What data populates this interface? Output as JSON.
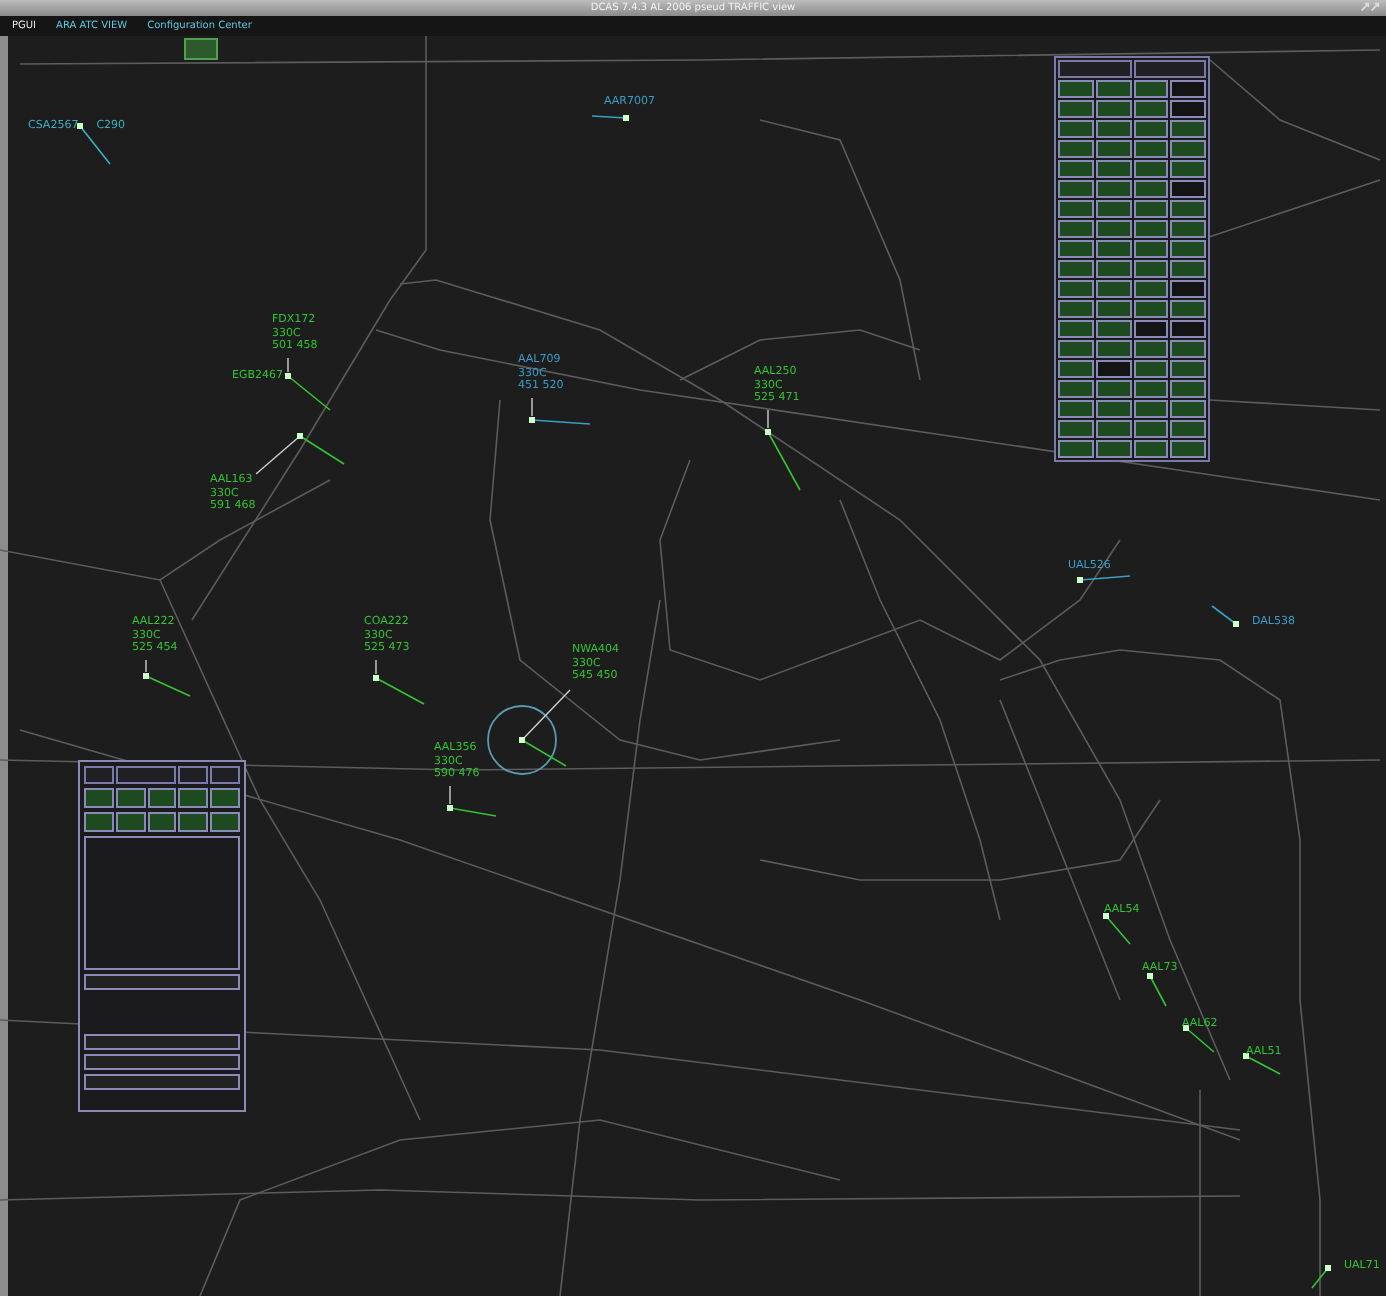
{
  "window": {
    "title": "DCAS 7.4.3 AL 2006 pseud TRAFFIC view"
  },
  "menu": [
    {
      "label": "PGUI"
    },
    {
      "label": "ARA ATC VIEW"
    },
    {
      "label": "Configuration Center"
    }
  ],
  "aircraft": [
    {
      "kind": "inline",
      "lines": [
        "CSA2567",
        "C290"
      ],
      "color": "#3ab0c0"
    },
    {
      "kind": "inline",
      "lines": [
        "AAR7007"
      ],
      "color": "#3a9ec8"
    },
    {
      "kind": "stacked",
      "lines": [
        "FDX172",
        "330C",
        "501 458"
      ],
      "color": "#33c433"
    },
    {
      "kind": "inline",
      "lines": [
        "EGB2467"
      ],
      "color": "#33c433"
    },
    {
      "kind": "stacked",
      "lines": [
        "AAL163",
        "330C",
        "591 468"
      ],
      "color": "#33c433"
    },
    {
      "kind": "stacked",
      "lines": [
        "AAL709",
        "330C",
        "451 520"
      ],
      "color": "#3a9ec8"
    },
    {
      "kind": "stacked",
      "lines": [
        "AAL250",
        "330C",
        "525 471"
      ],
      "color": "#33c433"
    },
    {
      "kind": "stacked",
      "lines": [
        "AAL222",
        "330C",
        "525 454"
      ],
      "color": "#33c433"
    },
    {
      "kind": "stacked",
      "lines": [
        "COA222",
        "330C",
        "525 473"
      ],
      "color": "#33c433"
    },
    {
      "kind": "stacked",
      "lines": [
        "NWA404",
        "330C",
        "545 450"
      ],
      "color": "#33c433"
    },
    {
      "kind": "stacked",
      "lines": [
        "AAL356",
        "330C",
        "590 476"
      ],
      "color": "#33c433"
    },
    {
      "kind": "inline",
      "lines": [
        "UAL526"
      ],
      "color": "#3a9ec8"
    },
    {
      "kind": "inline",
      "lines": [
        "DAL538"
      ],
      "color": "#3a9ec8"
    },
    {
      "kind": "inline",
      "lines": [
        "AAL54"
      ],
      "color": "#33c433"
    },
    {
      "kind": "inline",
      "lines": [
        "AAL73"
      ],
      "color": "#33c433"
    },
    {
      "kind": "inline",
      "lines": [
        "AAL62"
      ],
      "color": "#33c433"
    },
    {
      "kind": "inline",
      "lines": [
        "AAL51"
      ],
      "color": "#33c433"
    },
    {
      "kind": "inline",
      "lines": [
        "UAL71"
      ],
      "color": "#33c433"
    }
  ],
  "right_panel": {
    "rows": [
      [
        {
          "kind": "button"
        },
        {
          "kind": "button"
        },
        {
          "kind": "button"
        },
        {
          "kind": "empty"
        }
      ],
      [
        {
          "kind": "button"
        },
        {
          "kind": "button"
        },
        {
          "kind": "button"
        },
        {
          "kind": "empty"
        }
      ],
      [
        {
          "kind": "button"
        },
        {
          "kind": "button"
        },
        {
          "kind": "button"
        },
        {
          "kind": "button"
        }
      ],
      [
        {
          "kind": "button"
        },
        {
          "kind": "button"
        },
        {
          "kind": "button"
        },
        {
          "kind": "button"
        }
      ],
      [
        {
          "kind": "button"
        },
        {
          "kind": "button"
        },
        {
          "kind": "button"
        },
        {
          "kind": "button"
        }
      ],
      [
        {
          "kind": "button"
        },
        {
          "kind": "button"
        },
        {
          "kind": "button"
        },
        {
          "kind": "empty"
        }
      ],
      [
        {
          "kind": "button"
        },
        {
          "kind": "button"
        },
        {
          "kind": "button"
        },
        {
          "kind": "button"
        }
      ],
      [
        {
          "kind": "button"
        },
        {
          "kind": "button"
        },
        {
          "kind": "button"
        },
        {
          "kind": "button"
        }
      ],
      [
        {
          "kind": "button"
        },
        {
          "kind": "button"
        },
        {
          "kind": "button"
        },
        {
          "kind": "button"
        }
      ],
      [
        {
          "kind": "button"
        },
        {
          "kind": "button"
        },
        {
          "kind": "button"
        },
        {
          "kind": "button"
        }
      ],
      [
        {
          "kind": "button"
        },
        {
          "kind": "button"
        },
        {
          "kind": "button"
        },
        {
          "kind": "empty"
        }
      ],
      [
        {
          "kind": "button"
        },
        {
          "kind": "button"
        },
        {
          "kind": "button"
        },
        {
          "kind": "button"
        }
      ],
      [
        {
          "kind": "button"
        },
        {
          "kind": "button"
        },
        {
          "kind": "empty"
        },
        {
          "kind": "empty"
        }
      ],
      [
        {
          "kind": "button"
        },
        {
          "kind": "button"
        },
        {
          "kind": "button"
        },
        {
          "kind": "button"
        }
      ],
      [
        {
          "kind": "button"
        },
        {
          "kind": "empty"
        },
        {
          "kind": "button"
        },
        {
          "kind": "button"
        }
      ],
      [
        {
          "kind": "button"
        },
        {
          "kind": "button"
        },
        {
          "kind": "button"
        },
        {
          "kind": "button"
        }
      ],
      [
        {
          "kind": "button"
        },
        {
          "kind": "button"
        },
        {
          "kind": "button"
        },
        {
          "kind": "button"
        }
      ],
      [
        {
          "kind": "button"
        },
        {
          "kind": "button"
        },
        {
          "kind": "button"
        },
        {
          "kind": "button"
        }
      ],
      [
        {
          "kind": "button"
        },
        {
          "kind": "button"
        },
        {
          "kind": "button"
        },
        {
          "kind": "button"
        }
      ]
    ]
  },
  "left_panel": {
    "rows": [
      [
        {
          "kind": "button"
        },
        {
          "kind": "button"
        },
        {
          "kind": "button"
        },
        {
          "kind": "button"
        },
        {
          "kind": "button"
        }
      ],
      [
        {
          "kind": "button"
        },
        {
          "kind": "button"
        },
        {
          "kind": "button"
        },
        {
          "kind": "button"
        },
        {
          "kind": "button"
        }
      ]
    ]
  }
}
